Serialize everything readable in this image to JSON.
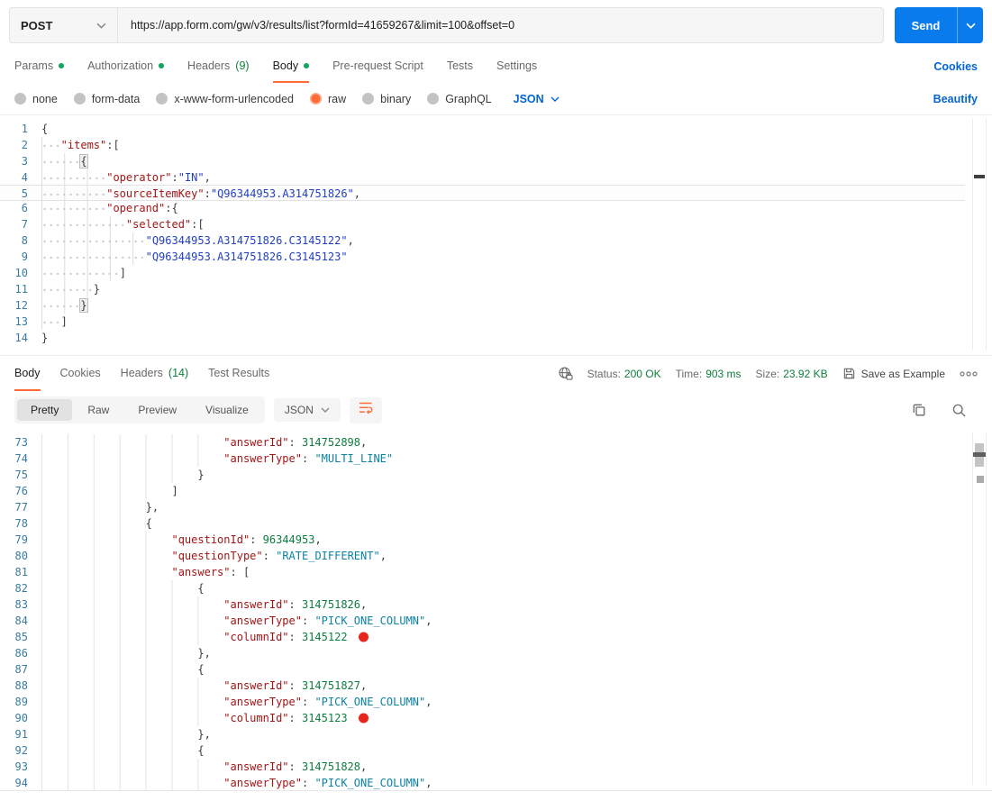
{
  "colors": {
    "accent_orange": "#FF6C37",
    "primary_blue": "#097BED",
    "link_blue": "#0265D2",
    "status_green": "#0E7E3C",
    "tab_dot_green": "#11A35A",
    "json_key_red": "#A31515",
    "request_string_blue": "#2240C4",
    "response_string_teal": "#0C82A5",
    "number_green": "#0E7E3E",
    "annotation_red": "#E8251A"
  },
  "request": {
    "method": "POST",
    "url": "https://app.form.com/gw/v3/results/list?formId=41659267&limit=100&offset=0",
    "send_label": "Send",
    "cookies_link": "Cookies",
    "beautify_link": "Beautify",
    "raw_language": "JSON",
    "tabs": [
      {
        "label": "Params",
        "dot": true
      },
      {
        "label": "Authorization",
        "dot": true
      },
      {
        "label": "Headers",
        "count": "(9)"
      },
      {
        "label": "Body",
        "dot": true,
        "active": true
      },
      {
        "label": "Pre-request Script"
      },
      {
        "label": "Tests"
      },
      {
        "label": "Settings"
      }
    ],
    "body_types": [
      {
        "label": "none"
      },
      {
        "label": "form-data"
      },
      {
        "label": "x-www-form-urlencoded"
      },
      {
        "label": "raw",
        "selected": true
      },
      {
        "label": "binary"
      },
      {
        "label": "GraphQL"
      }
    ]
  },
  "request_editor": {
    "lines": [
      {
        "n": 1,
        "indent": 0,
        "tokens": [
          [
            "p",
            "{"
          ]
        ]
      },
      {
        "n": 2,
        "indent": 3,
        "tokens": [
          [
            "k",
            "\"items\""
          ],
          [
            "p",
            ":"
          ],
          [
            "p",
            "["
          ]
        ]
      },
      {
        "n": 3,
        "indent": 6,
        "tokens": [
          [
            "b",
            "{"
          ]
        ]
      },
      {
        "n": 4,
        "indent": 10,
        "tokens": [
          [
            "k",
            "\"operator\""
          ],
          [
            "p",
            ":"
          ],
          [
            "s",
            "\"IN\""
          ],
          [
            "p",
            ","
          ]
        ]
      },
      {
        "n": 5,
        "indent": 10,
        "active": true,
        "tokens": [
          [
            "k",
            "\"sourceItemKey\""
          ],
          [
            "p",
            ":"
          ],
          [
            "s",
            "\"Q96344953.A314751826\""
          ],
          [
            "p",
            ","
          ]
        ]
      },
      {
        "n": 6,
        "indent": 10,
        "tokens": [
          [
            "k",
            "\"operand\""
          ],
          [
            "p",
            ":"
          ],
          [
            "p",
            "{"
          ]
        ]
      },
      {
        "n": 7,
        "indent": 13,
        "tokens": [
          [
            "k",
            "\"selected\""
          ],
          [
            "p",
            ":"
          ],
          [
            "p",
            "["
          ]
        ]
      },
      {
        "n": 8,
        "indent": 16,
        "tokens": [
          [
            "s",
            "\"Q96344953.A314751826.C3145122\""
          ],
          [
            "p",
            ","
          ]
        ]
      },
      {
        "n": 9,
        "indent": 16,
        "tokens": [
          [
            "s",
            "\"Q96344953.A314751826.C3145123\""
          ]
        ]
      },
      {
        "n": 10,
        "indent": 12,
        "tokens": [
          [
            "p",
            "]"
          ]
        ]
      },
      {
        "n": 11,
        "indent": 8,
        "tokens": [
          [
            "p",
            "}"
          ]
        ]
      },
      {
        "n": 12,
        "indent": 6,
        "tokens": [
          [
            "b",
            "}"
          ]
        ]
      },
      {
        "n": 13,
        "indent": 3,
        "tokens": [
          [
            "p",
            "]"
          ]
        ]
      },
      {
        "n": 14,
        "indent": 0,
        "tokens": [
          [
            "p",
            "}"
          ]
        ]
      }
    ]
  },
  "response": {
    "tabs": [
      {
        "label": "Body",
        "active": true
      },
      {
        "label": "Cookies"
      },
      {
        "label": "Headers",
        "count": "(14)"
      },
      {
        "label": "Test Results"
      }
    ],
    "status_label": "Status:",
    "status_value": "200 OK",
    "time_label": "Time:",
    "time_value": "903 ms",
    "size_label": "Size:",
    "size_value": "23.92 KB",
    "save_as_example_label": "Save as Example",
    "views": [
      {
        "label": "Pretty",
        "active": true
      },
      {
        "label": "Raw"
      },
      {
        "label": "Preview"
      },
      {
        "label": "Visualize"
      }
    ],
    "language": "JSON"
  },
  "response_editor": {
    "lines": [
      {
        "n": 73,
        "indent": 28,
        "tokens": [
          [
            "k",
            "\"answerId\""
          ],
          [
            "p",
            ": "
          ],
          [
            "n",
            "314752898"
          ],
          [
            "p",
            ","
          ]
        ]
      },
      {
        "n": 74,
        "indent": 28,
        "tokens": [
          [
            "k",
            "\"answerType\""
          ],
          [
            "p",
            ": "
          ],
          [
            "s",
            "\"MULTI_LINE\""
          ]
        ]
      },
      {
        "n": 75,
        "indent": 24,
        "tokens": [
          [
            "p",
            "}"
          ]
        ]
      },
      {
        "n": 76,
        "indent": 20,
        "tokens": [
          [
            "p",
            "]"
          ]
        ]
      },
      {
        "n": 77,
        "indent": 16,
        "tokens": [
          [
            "p",
            "},"
          ]
        ]
      },
      {
        "n": 78,
        "indent": 16,
        "tokens": [
          [
            "p",
            "{"
          ]
        ]
      },
      {
        "n": 79,
        "indent": 20,
        "tokens": [
          [
            "k",
            "\"questionId\""
          ],
          [
            "p",
            ": "
          ],
          [
            "n",
            "96344953"
          ],
          [
            "p",
            ","
          ]
        ]
      },
      {
        "n": 80,
        "indent": 20,
        "tokens": [
          [
            "k",
            "\"questionType\""
          ],
          [
            "p",
            ": "
          ],
          [
            "s",
            "\"RATE_DIFFERENT\""
          ],
          [
            "p",
            ","
          ]
        ]
      },
      {
        "n": 81,
        "indent": 20,
        "tokens": [
          [
            "k",
            "\"answers\""
          ],
          [
            "p",
            ": "
          ],
          [
            "p",
            "["
          ]
        ]
      },
      {
        "n": 82,
        "indent": 24,
        "tokens": [
          [
            "p",
            "{"
          ]
        ]
      },
      {
        "n": 83,
        "indent": 28,
        "tokens": [
          [
            "k",
            "\"answerId\""
          ],
          [
            "p",
            ": "
          ],
          [
            "n",
            "314751826"
          ],
          [
            "p",
            ","
          ]
        ]
      },
      {
        "n": 84,
        "indent": 28,
        "tokens": [
          [
            "k",
            "\"answerType\""
          ],
          [
            "p",
            ": "
          ],
          [
            "s",
            "\"PICK_ONE_COLUMN\""
          ],
          [
            "p",
            ","
          ]
        ]
      },
      {
        "n": 85,
        "indent": 28,
        "tokens": [
          [
            "k",
            "\"columnId\""
          ],
          [
            "p",
            ": "
          ],
          [
            "n",
            "3145122"
          ]
        ],
        "marker": "red-dot"
      },
      {
        "n": 86,
        "indent": 24,
        "tokens": [
          [
            "p",
            "},"
          ]
        ]
      },
      {
        "n": 87,
        "indent": 24,
        "tokens": [
          [
            "p",
            "{"
          ]
        ]
      },
      {
        "n": 88,
        "indent": 28,
        "tokens": [
          [
            "k",
            "\"answerId\""
          ],
          [
            "p",
            ": "
          ],
          [
            "n",
            "314751827"
          ],
          [
            "p",
            ","
          ]
        ]
      },
      {
        "n": 89,
        "indent": 28,
        "tokens": [
          [
            "k",
            "\"answerType\""
          ],
          [
            "p",
            ": "
          ],
          [
            "s",
            "\"PICK_ONE_COLUMN\""
          ],
          [
            "p",
            ","
          ]
        ]
      },
      {
        "n": 90,
        "indent": 28,
        "tokens": [
          [
            "k",
            "\"columnId\""
          ],
          [
            "p",
            ": "
          ],
          [
            "n",
            "3145123"
          ]
        ],
        "marker": "red-dot"
      },
      {
        "n": 91,
        "indent": 24,
        "tokens": [
          [
            "p",
            "},"
          ]
        ]
      },
      {
        "n": 92,
        "indent": 24,
        "tokens": [
          [
            "p",
            "{"
          ]
        ]
      },
      {
        "n": 93,
        "indent": 28,
        "tokens": [
          [
            "k",
            "\"answerId\""
          ],
          [
            "p",
            ": "
          ],
          [
            "n",
            "314751828"
          ],
          [
            "p",
            ","
          ]
        ]
      },
      {
        "n": 94,
        "indent": 28,
        "tokens": [
          [
            "k",
            "\"answerType\""
          ],
          [
            "p",
            ": "
          ],
          [
            "s",
            "\"PICK_ONE_COLUMN\""
          ],
          [
            "p",
            ","
          ]
        ]
      }
    ]
  }
}
